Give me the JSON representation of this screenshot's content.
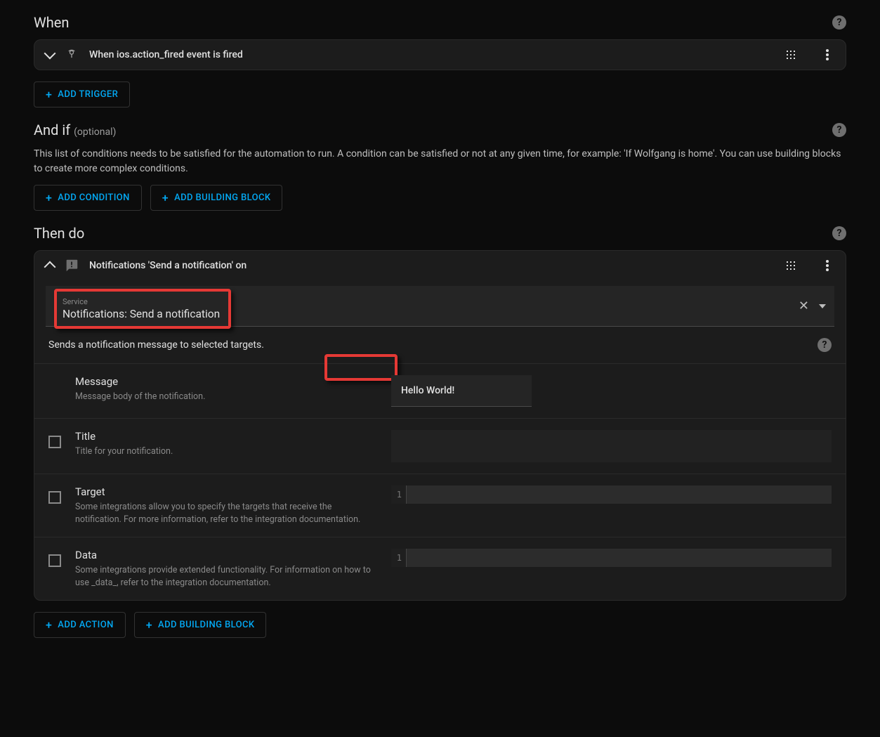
{
  "sections": {
    "when": {
      "title": "When"
    },
    "andif": {
      "title": "And if",
      "optional": "(optional)",
      "description": "This list of conditions needs to be satisfied for the automation to run. A condition can be satisfied or not at any given time, for example: 'If Wolfgang is home'. You can use building blocks to create more complex conditions."
    },
    "thendo": {
      "title": "Then do"
    }
  },
  "trigger": {
    "summary": "When ios.action_fired event is fired"
  },
  "action": {
    "summary": "Notifications 'Send a notification' on",
    "service_label": "Service",
    "service_value": "Notifications: Send a notification",
    "service_description": "Sends a notification message to selected targets.",
    "fields": {
      "message": {
        "name": "Message",
        "help": "Message body of the notification.",
        "value": "Hello World!"
      },
      "title": {
        "name": "Title",
        "help": "Title for your notification."
      },
      "target": {
        "name": "Target",
        "help": "Some integrations allow you to specify the targets that receive the notification. For more information, refer to the integration documentation.",
        "line_no": "1"
      },
      "data": {
        "name": "Data",
        "help": "Some integrations provide extended functionality. For information on how to use _data_, refer to the integration documentation.",
        "line_no": "1"
      }
    }
  },
  "buttons": {
    "add_trigger": "ADD TRIGGER",
    "add_condition": "ADD CONDITION",
    "add_building_block": "ADD BUILDING BLOCK",
    "add_action": "ADD ACTION"
  }
}
